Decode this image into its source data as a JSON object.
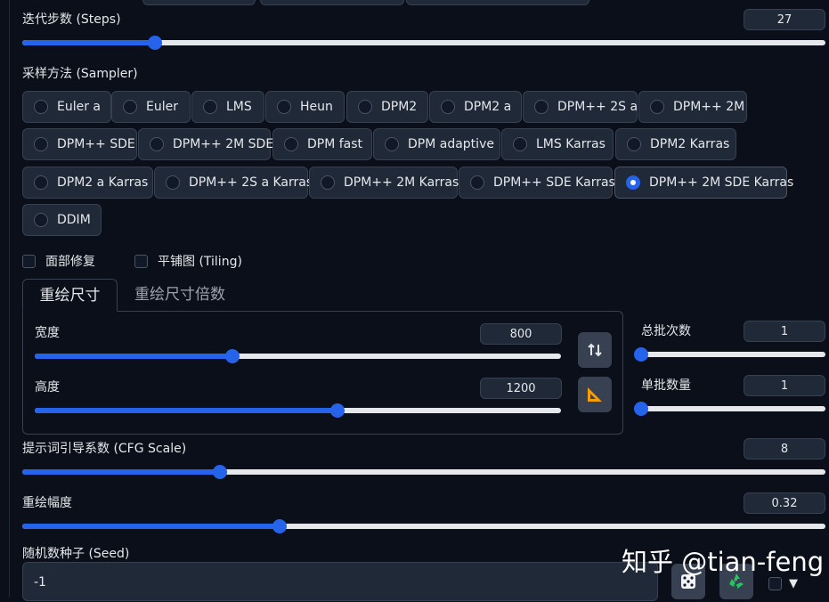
{
  "steps": {
    "label": "迭代步数 (Steps)",
    "value": "27",
    "fraction": 0.165
  },
  "sampler": {
    "label": "采样方法 (Sampler)",
    "options": [
      "Euler a",
      "Euler",
      "LMS",
      "Heun",
      "DPM2",
      "DPM2 a",
      "DPM++ 2S a",
      "DPM++ 2M",
      "DPM++ SDE",
      "DPM++ 2M SDE",
      "DPM fast",
      "DPM adaptive",
      "LMS Karras",
      "DPM2 Karras",
      "DPM2 a Karras",
      "DPM++ 2S a Karras",
      "DPM++ 2M Karras",
      "DPM++ SDE Karras",
      "DPM++ 2M SDE Karras",
      "DDIM"
    ],
    "selected": "DPM++ 2M SDE Karras"
  },
  "checkboxes": {
    "face_restore": "面部修复",
    "tiling": "平铺图 (Tiling)"
  },
  "tabs": {
    "resize": "重绘尺寸",
    "scale": "重绘尺寸倍数"
  },
  "width": {
    "label": "宽度",
    "value": "800",
    "fraction": 0.375
  },
  "height": {
    "label": "高度",
    "value": "1200",
    "fraction": 0.575
  },
  "batch_count": {
    "label": "总批次数",
    "value": "1",
    "fraction": 0.0
  },
  "batch_size": {
    "label": "单批数量",
    "value": "1",
    "fraction": 0.0
  },
  "cfg": {
    "label": "提示词引导系数 (CFG Scale)",
    "value": "8",
    "fraction": 0.246
  },
  "denoise": {
    "label": "重绘幅度",
    "value": "0.32",
    "fraction": 0.32
  },
  "seed": {
    "label": "随机数种子 (Seed)",
    "value": "-1"
  },
  "watermark": "知乎 @tian-feng",
  "colors": {
    "accent": "#2563eb",
    "background": "#0b0f19",
    "surface": "#1f2937",
    "border": "#374151"
  }
}
